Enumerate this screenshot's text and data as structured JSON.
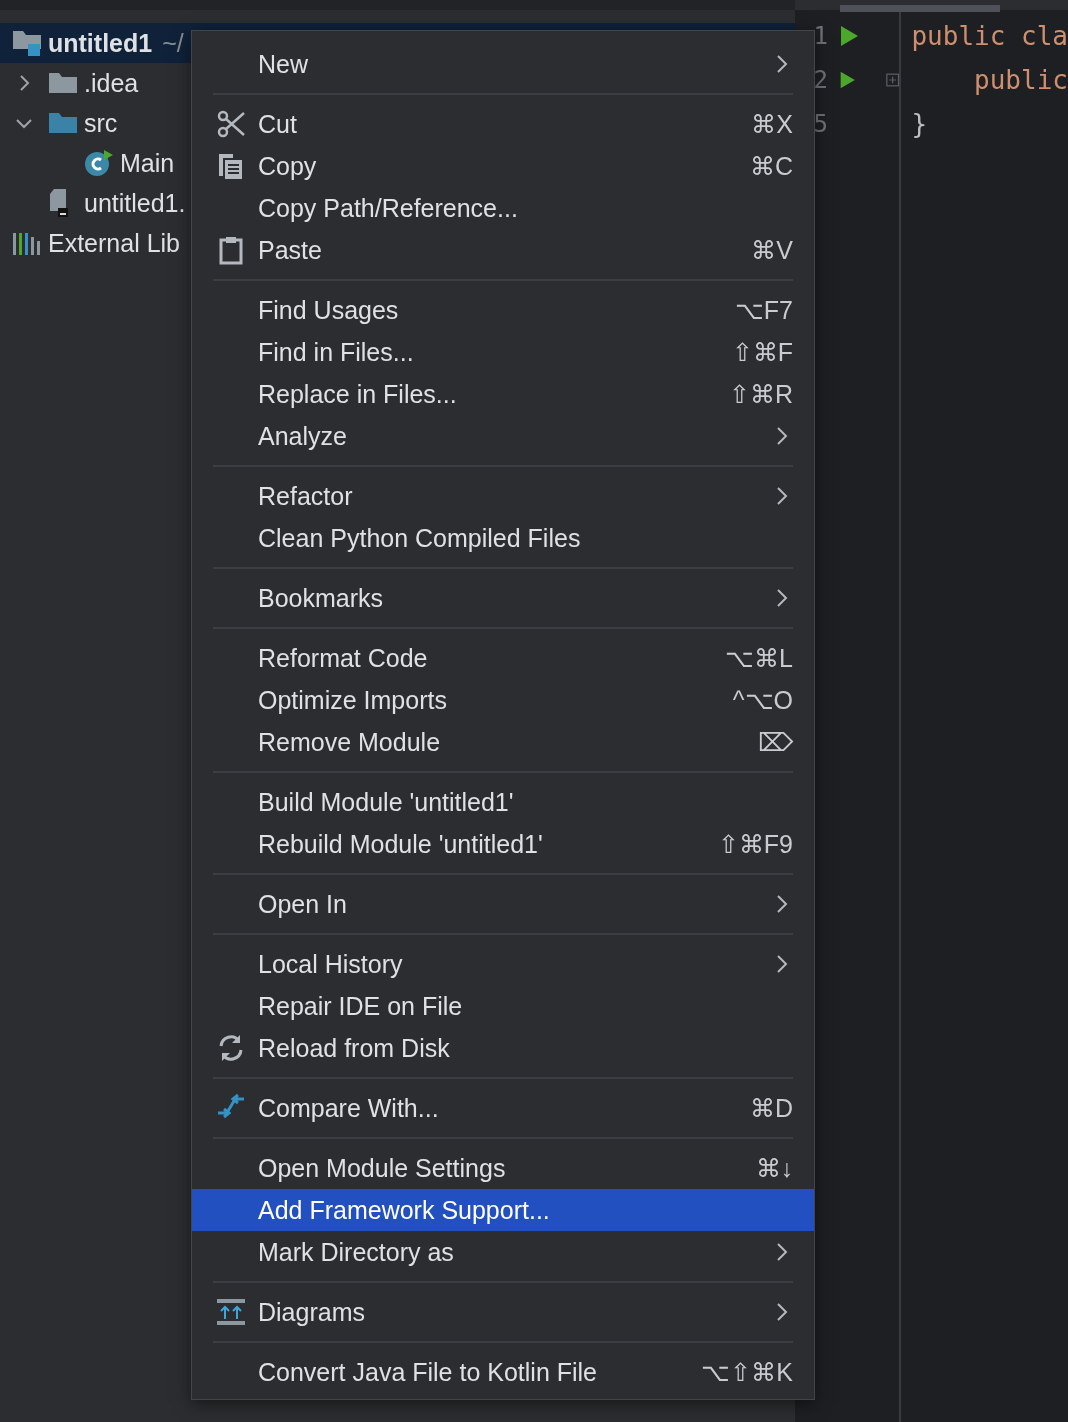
{
  "project_tree": [
    {
      "label": "untitled1",
      "path": "~/",
      "kind": "module",
      "selected": true,
      "children": [
        {
          "label": ".idea",
          "kind": "folder",
          "expanded": false,
          "selected": false
        },
        {
          "label": "src",
          "kind": "source-folder",
          "expanded": true,
          "selected": false,
          "children": [
            {
              "label": "Main",
              "kind": "class",
              "selected": false
            }
          ]
        },
        {
          "label": "untitled1.",
          "kind": "iml",
          "selected": false
        }
      ]
    },
    {
      "label": "External Lib",
      "kind": "libraries",
      "selected": false
    }
  ],
  "editor": {
    "lines": [
      {
        "number": "1",
        "run": true,
        "fold": false,
        "code": "public cla",
        "kind": "keyword"
      },
      {
        "number": "2",
        "run": true,
        "fold": true,
        "code": "    public",
        "kind": "keyword"
      },
      {
        "number": "5",
        "run": false,
        "fold": false,
        "code": "}",
        "kind": "brace"
      }
    ]
  },
  "context_menu": {
    "groups": [
      [
        {
          "label": "New",
          "submenu": true,
          "selected": false
        }
      ],
      [
        {
          "label": "Cut",
          "kind": "cut",
          "shortcut": "⌘X",
          "selected": false
        },
        {
          "label": "Copy",
          "kind": "copy",
          "shortcut": "⌘C",
          "selected": false
        },
        {
          "label": "Copy Path/Reference...",
          "selected": false
        },
        {
          "label": "Paste",
          "kind": "paste",
          "shortcut": "⌘V",
          "selected": false
        }
      ],
      [
        {
          "label": "Find Usages",
          "shortcut": "⌥F7",
          "selected": false
        },
        {
          "label": "Find in Files...",
          "shortcut": "⇧⌘F",
          "selected": false
        },
        {
          "label": "Replace in Files...",
          "shortcut": "⇧⌘R",
          "selected": false
        },
        {
          "label": "Analyze",
          "submenu": true,
          "selected": false
        }
      ],
      [
        {
          "label": "Refactor",
          "submenu": true,
          "selected": false
        },
        {
          "label": "Clean Python Compiled Files",
          "selected": false
        }
      ],
      [
        {
          "label": "Bookmarks",
          "submenu": true,
          "selected": false
        }
      ],
      [
        {
          "label": "Reformat Code",
          "shortcut": "⌥⌘L",
          "selected": false
        },
        {
          "label": "Optimize Imports",
          "shortcut": "^⌥O",
          "selected": false
        },
        {
          "label": "Remove Module",
          "shortcut": "⌦",
          "selected": false
        }
      ],
      [
        {
          "label": "Build Module 'untitled1'",
          "selected": false
        },
        {
          "label": "Rebuild Module 'untitled1'",
          "shortcut": "⇧⌘F9",
          "selected": false
        }
      ],
      [
        {
          "label": "Open In",
          "submenu": true,
          "selected": false
        }
      ],
      [
        {
          "label": "Local History",
          "submenu": true,
          "selected": false
        },
        {
          "label": "Repair IDE on File",
          "selected": false
        },
        {
          "label": "Reload from Disk",
          "kind": "reload",
          "selected": false
        }
      ],
      [
        {
          "label": "Compare With...",
          "kind": "compare",
          "shortcut": "⌘D",
          "selected": false
        }
      ],
      [
        {
          "label": "Open Module Settings",
          "shortcut": "⌘↓",
          "selected": false
        },
        {
          "label": "Add Framework Support...",
          "selected": true
        },
        {
          "label": "Mark Directory as",
          "submenu": true,
          "selected": false
        }
      ],
      [
        {
          "label": "Diagrams",
          "kind": "diagrams",
          "submenu": true,
          "selected": false
        }
      ],
      [
        {
          "label": "Convert Java File to Kotlin File",
          "shortcut": "⌥⇧⌘K",
          "selected": false
        }
      ]
    ]
  }
}
